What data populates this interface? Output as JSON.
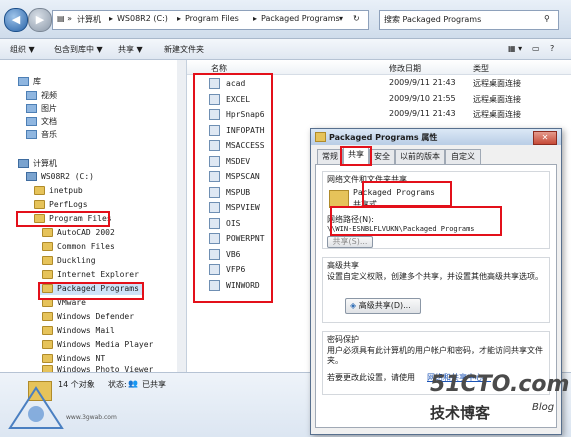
{
  "address": {
    "segments": [
      "计算机",
      "WS08R2 (C:)",
      "Program Files",
      "Packaged Programs"
    ],
    "search_placeholder": "搜索 Packaged Programs"
  },
  "toolbar": {
    "organize": "组织 ▼",
    "include": "包含到库中 ▼",
    "share": "共享 ▼",
    "new_folder": "新建文件夹"
  },
  "nav": {
    "library": "库",
    "library_items": [
      "视频",
      "图片",
      "文档",
      "音乐"
    ],
    "computer": "计算机",
    "drive": "WS08R2 (C:)",
    "c_items": [
      "inetpub",
      "PerfLogs",
      "Program Files"
    ],
    "pf_items": [
      "AutoCAD 2002",
      "Common Files",
      "Duckling",
      "Internet Explorer",
      "Packaged Programs",
      "VMware",
      "Windows Defender",
      "Windows Mail",
      "Windows Media Player",
      "Windows NT",
      "Windows Photo Viewer"
    ]
  },
  "list": {
    "headers": {
      "name": "名称",
      "date": "修改日期",
      "type": "类型"
    },
    "files": [
      {
        "name": "acad",
        "date": "2009/9/11 21:43",
        "type": "远程桌面连接"
      },
      {
        "name": "EXCEL",
        "date": "2009/9/10 21:55",
        "type": "远程桌面连接"
      },
      {
        "name": "HprSnap6",
        "date": "2009/9/11 21:43",
        "type": "远程桌面连接"
      },
      {
        "name": "INFOPATH",
        "date": "",
        "type": ""
      },
      {
        "name": "MSACCESS",
        "date": "",
        "type": ""
      },
      {
        "name": "MSDEV",
        "date": "",
        "type": ""
      },
      {
        "name": "MSPSCAN",
        "date": "",
        "type": ""
      },
      {
        "name": "MSPUB",
        "date": "",
        "type": ""
      },
      {
        "name": "MSPVIEW",
        "date": "",
        "type": ""
      },
      {
        "name": "OIS",
        "date": "",
        "type": ""
      },
      {
        "name": "POWERPNT",
        "date": "",
        "type": ""
      },
      {
        "name": "VB6",
        "date": "",
        "type": ""
      },
      {
        "name": "VFP6",
        "date": "",
        "type": ""
      },
      {
        "name": "WINWORD",
        "date": "",
        "type": ""
      }
    ]
  },
  "status": {
    "count": "14 个对象",
    "state_label": "状态:",
    "state": "已共享"
  },
  "dialog": {
    "title": "Packaged Programs 属性",
    "close": "✕",
    "tabs": [
      "常规",
      "共享",
      "安全",
      "以前的版本",
      "自定义"
    ],
    "share_group_title": "网络文件和文件夹共享",
    "folder_name": "Packaged Programs",
    "folder_state": "共享式",
    "path_label": "网络路径(N):",
    "path_value": "\\\\WIN-ESNBLFLVUKN\\Packaged Programs",
    "share_button": "共享(S)...",
    "adv_title": "高级共享",
    "adv_desc": "设置自定义权限，创建多个共享，并设置其他高级共享选项。",
    "adv_button": "高级共享(D)...",
    "pwd_title": "密码保护",
    "pwd_desc": "用户必须具有此计算机的用户帐户和密码，才能访问共享文件夹。",
    "pwd_link_prefix": "若要更改此设置，请使用",
    "pwd_link": "网络和共享中心。"
  },
  "watermark": {
    "site": "51CTO.com",
    "brand": "技术博客",
    "blog": "Blog",
    "small": "www.3gwab.com"
  }
}
